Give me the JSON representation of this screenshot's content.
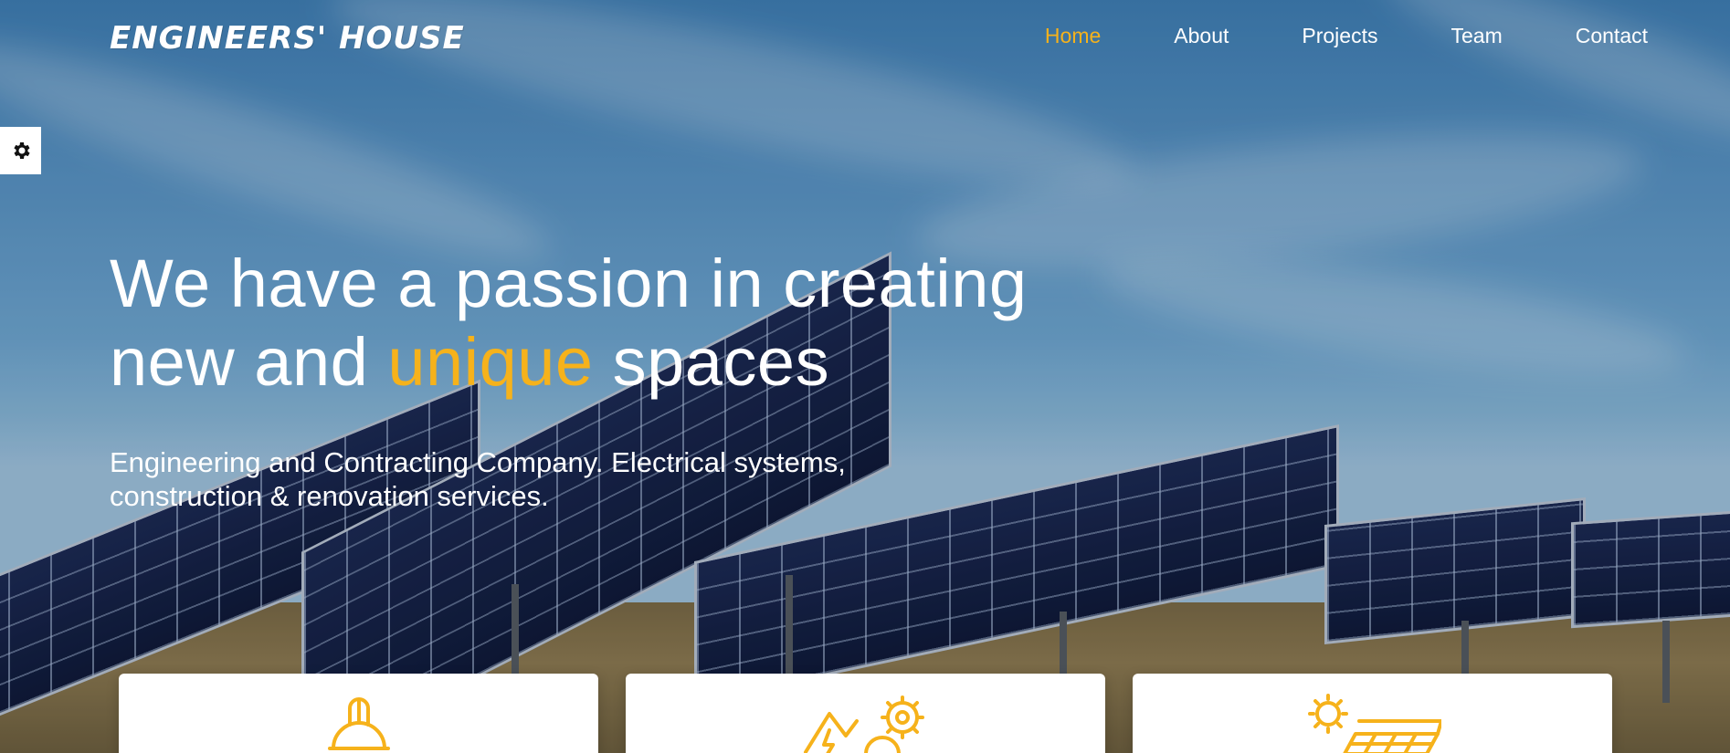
{
  "brand": {
    "logo_text": "ENGINEERS' HOUSE"
  },
  "nav": {
    "items": [
      {
        "label": "Home",
        "active": true
      },
      {
        "label": "About",
        "active": false
      },
      {
        "label": "Projects",
        "active": false
      },
      {
        "label": "Team",
        "active": false
      },
      {
        "label": "Contact",
        "active": false
      }
    ]
  },
  "settings_panel": {
    "icon": "gear-icon"
  },
  "hero": {
    "headline_line1": "We have a passion in creating",
    "headline_line2_before": "new and ",
    "headline_line2_accent": "unique",
    "headline_line2_after": " spaces",
    "subtitle_line1": "Engineering and Contracting Company. Electrical systems,",
    "subtitle_line2": "construction & renovation services."
  },
  "service_cards": [
    {
      "icon": "hard-hat-icon"
    },
    {
      "icon": "electrical-tools-gear-icon"
    },
    {
      "icon": "solar-panel-sun-icon"
    }
  ],
  "colors": {
    "accent": "#f6b21b",
    "text": "#ffffff",
    "card_bg": "#ffffff"
  }
}
